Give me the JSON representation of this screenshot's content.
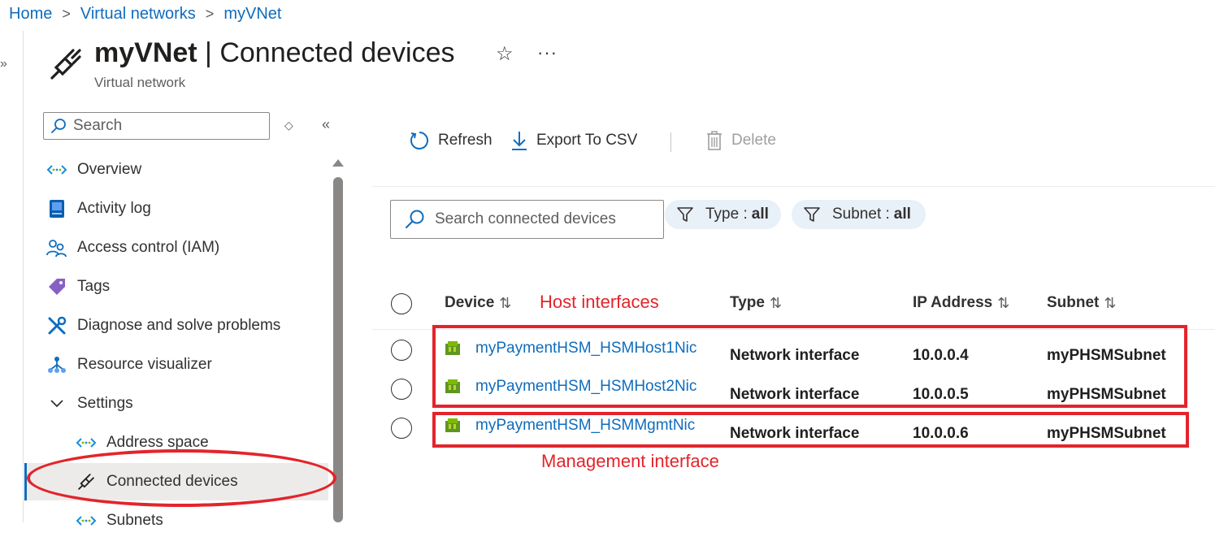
{
  "breadcrumb": [
    "Home",
    "Virtual networks",
    "myVNet"
  ],
  "header": {
    "title_bold": "myVNet",
    "title_rest": " | Connected devices",
    "subtitle": "Virtual network",
    "more": "···"
  },
  "sidebar": {
    "search_placeholder": "Search",
    "items": [
      {
        "label": "Overview",
        "icon": "vnet-icon"
      },
      {
        "label": "Activity log",
        "icon": "activity-log-icon"
      },
      {
        "label": "Access control (IAM)",
        "icon": "people-icon"
      },
      {
        "label": "Tags",
        "icon": "tag-icon"
      },
      {
        "label": "Diagnose and solve problems",
        "icon": "wrench-icon"
      },
      {
        "label": "Resource visualizer",
        "icon": "hierarchy-icon"
      },
      {
        "label": "Settings",
        "icon": "chevron-down-icon"
      },
      {
        "label": "Address space",
        "icon": "vnet-icon"
      },
      {
        "label": "Connected devices",
        "icon": "plug-icon"
      },
      {
        "label": "Subnets",
        "icon": "vnet-icon"
      }
    ],
    "selected": "Connected devices"
  },
  "toolbar": {
    "refresh": "Refresh",
    "export": "Export To CSV",
    "delete": "Delete"
  },
  "filters": {
    "search_placeholder": "Search connected devices",
    "type_label": "Type :",
    "type_value": "all",
    "subnet_label": "Subnet :",
    "subnet_value": "all"
  },
  "table": {
    "columns": [
      "Device",
      "Type",
      "IP Address",
      "Subnet"
    ],
    "sort_icon": "⇅",
    "rows": [
      {
        "device": "myPaymentHSM_HSMHost1Nic",
        "type": "Network interface",
        "ip": "10.0.0.4",
        "subnet": "myPHSMSubnet"
      },
      {
        "device": "myPaymentHSM_HSMHost2Nic",
        "type": "Network interface",
        "ip": "10.0.0.5",
        "subnet": "myPHSMSubnet"
      },
      {
        "device": "myPaymentHSM_HSMMgmtNic",
        "type": "Network interface",
        "ip": "10.0.0.6",
        "subnet": "myPHSMSubnet"
      }
    ]
  },
  "annotations": {
    "host": "Host interfaces",
    "management": "Management interface"
  },
  "colors": {
    "accent": "#0f6cbd",
    "annotation": "#e3242b",
    "pill": "#e8f0f8"
  }
}
